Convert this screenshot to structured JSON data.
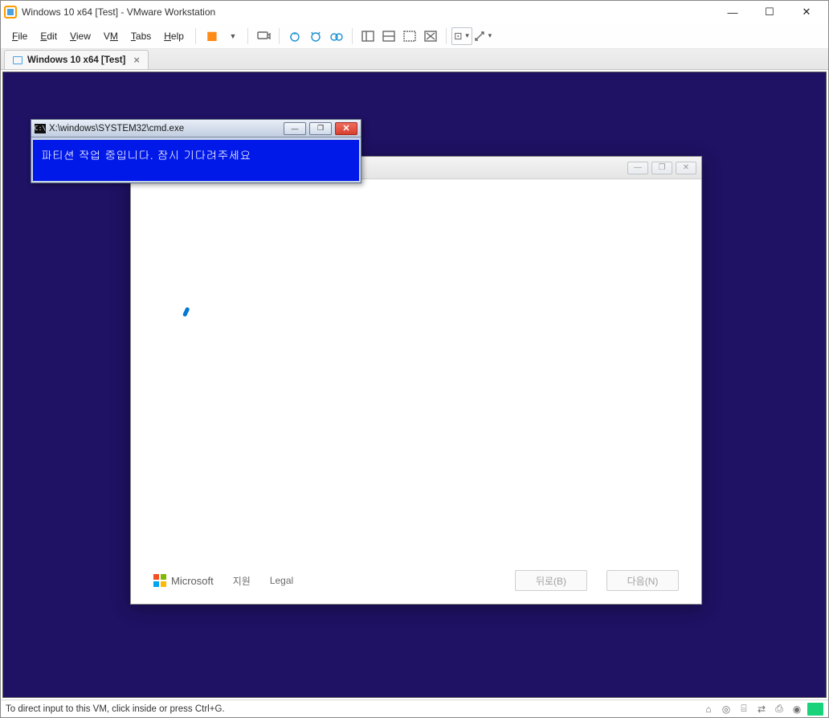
{
  "vmware": {
    "title": "Windows 10 x64 [Test] - VMware Workstation",
    "menu": {
      "file": "File",
      "edit": "Edit",
      "view": "View",
      "vm": "VM",
      "tabs": "Tabs",
      "help": "Help"
    },
    "tab": "Windows 10 x64 [Test]",
    "status": "To direct input to this VM, click inside or press Ctrl+G."
  },
  "cmd": {
    "title": "X:\\windows\\SYSTEM32\\cmd.exe",
    "text": "파티션 작업 중입니다. 잠시 기다려주세요"
  },
  "setup": {
    "brand": "Microsoft",
    "support": "지원",
    "legal": "Legal",
    "back": "뒤로(B)",
    "next": "다음(N)"
  },
  "glyph": {
    "min": "—",
    "max": "☐",
    "close": "✕",
    "tabx": "×",
    "winmin": "—",
    "winmax": "❐",
    "winx": "✕"
  }
}
